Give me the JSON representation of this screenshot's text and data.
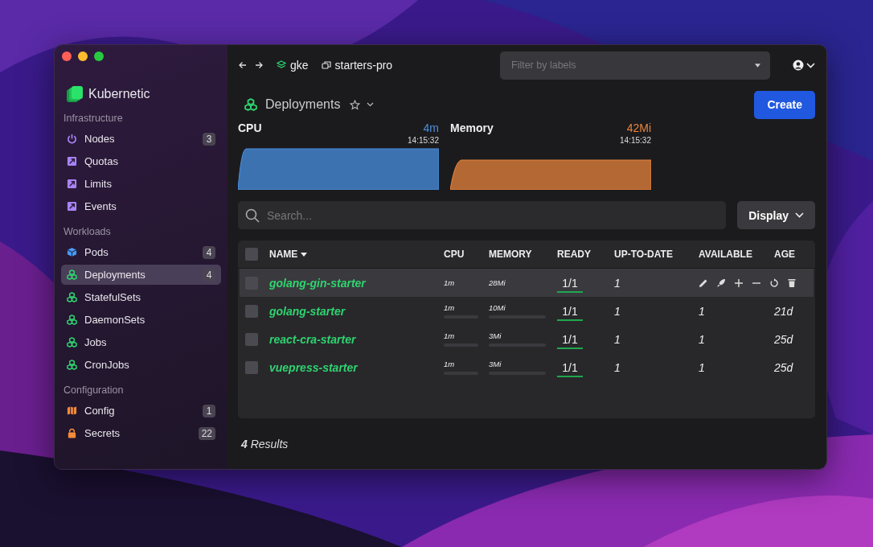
{
  "app": {
    "name": "Kubernetic"
  },
  "sidebar": {
    "sections": [
      {
        "title": "Infrastructure",
        "items": [
          {
            "label": "Nodes",
            "kind": "power",
            "count": "3",
            "selected": false
          },
          {
            "label": "Quotas",
            "kind": "link",
            "selected": false
          },
          {
            "label": "Limits",
            "kind": "link",
            "selected": false
          },
          {
            "label": "Events",
            "kind": "link",
            "selected": false
          }
        ]
      },
      {
        "title": "Workloads",
        "items": [
          {
            "label": "Pods",
            "kind": "cube",
            "count": "4",
            "selected": false
          },
          {
            "label": "Deployments",
            "kind": "stack",
            "count": "4",
            "selected": true
          },
          {
            "label": "StatefulSets",
            "kind": "stack",
            "selected": false
          },
          {
            "label": "DaemonSets",
            "kind": "stack",
            "selected": false
          },
          {
            "label": "Jobs",
            "kind": "stack",
            "selected": false
          },
          {
            "label": "CronJobs",
            "kind": "stack",
            "selected": false
          }
        ]
      },
      {
        "title": "Configuration",
        "items": [
          {
            "label": "Config",
            "kind": "map",
            "count": "1",
            "selected": false
          },
          {
            "label": "Secrets",
            "kind": "lock",
            "count": "22",
            "selected": false
          }
        ]
      }
    ]
  },
  "topbar": {
    "cluster": "gke",
    "namespace": "starters-pro",
    "filter": {
      "placeholder": "Filter by labels"
    }
  },
  "header": {
    "title": "Deployments",
    "create": "Create"
  },
  "metrics": [
    {
      "label": "CPU",
      "value": "4m",
      "time": "14:15:32",
      "color": "#4a90e2"
    },
    {
      "label": "Memory",
      "value": "42Mi",
      "time": "14:15:32",
      "color": "#e8843c"
    }
  ],
  "search": {
    "placeholder": "Search..."
  },
  "display": "Display",
  "table": {
    "select_all_checked": false,
    "columns": [
      "NAME",
      "CPU",
      "MEMORY",
      "READY",
      "UP-TO-DATE",
      "AVAILABLE",
      "AGE"
    ],
    "rows": [
      {
        "name": "golang-gin-starter",
        "cpu": "1m",
        "memory": "28Mi",
        "ready": "1/1",
        "uptodate": "1",
        "hovered": true,
        "checked": false
      },
      {
        "name": "golang-starter",
        "cpu": "1m",
        "memory": "10Mi",
        "ready": "1/1",
        "uptodate": "1",
        "available": "1",
        "age": "21d",
        "hovered": false,
        "checked": false
      },
      {
        "name": "react-cra-starter",
        "cpu": "1m",
        "memory": "3Mi",
        "ready": "1/1",
        "uptodate": "1",
        "available": "1",
        "age": "25d",
        "hovered": false,
        "checked": false
      },
      {
        "name": "vuepress-starter",
        "cpu": "1m",
        "memory": "3Mi",
        "ready": "1/1",
        "uptodate": "1",
        "available": "1",
        "age": "25d",
        "hovered": false,
        "checked": false
      }
    ]
  },
  "results": {
    "count": "4",
    "label": "Results"
  }
}
